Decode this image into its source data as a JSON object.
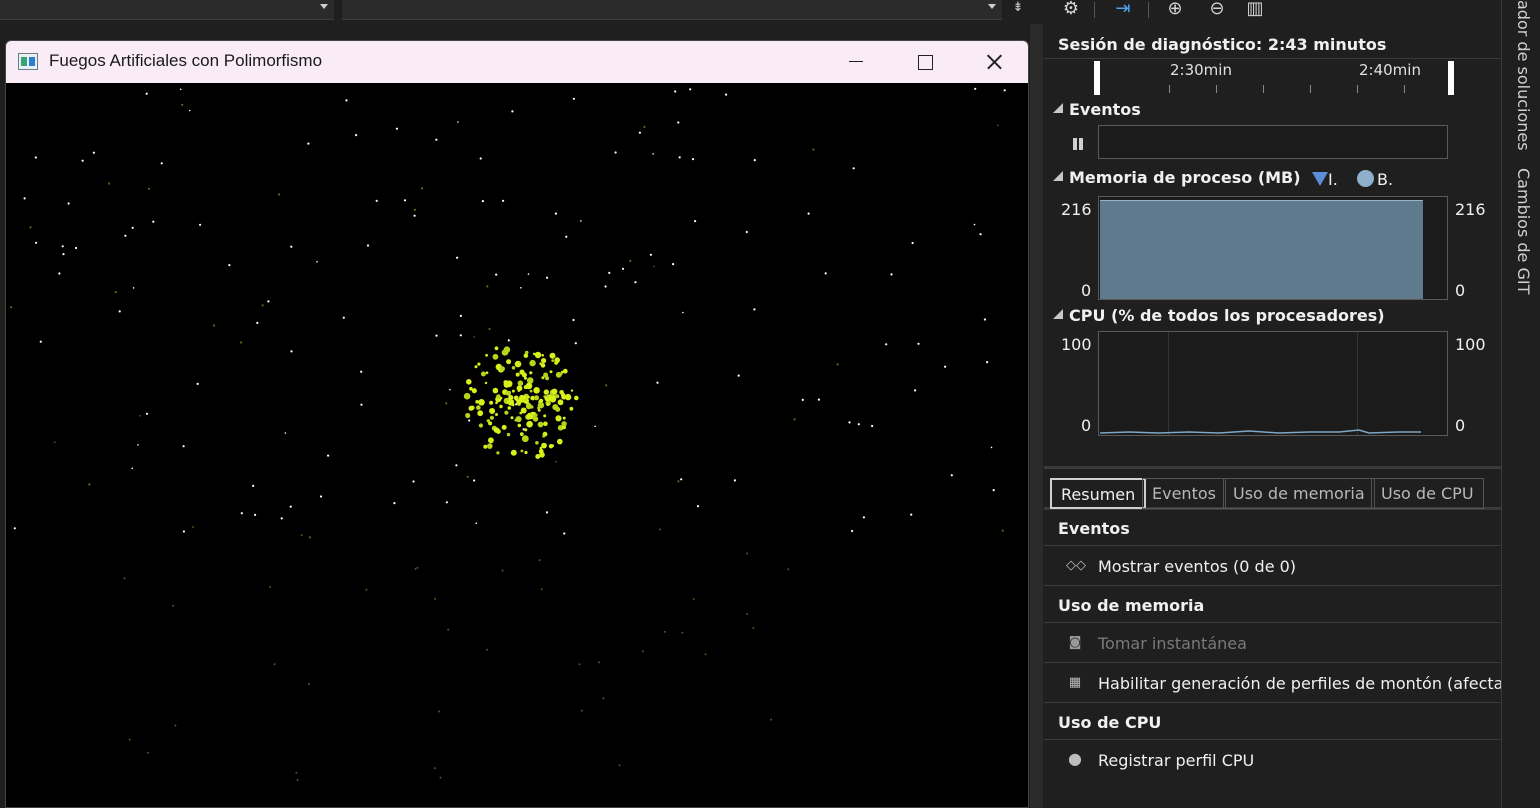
{
  "app_window": {
    "title": "Fuegos Artificiales con Polimorfismo",
    "minimize_icon": "minimize-icon",
    "maximize_icon": "maximize-icon",
    "close_icon": "close-icon",
    "background": "#000000",
    "firework_color": "#d8f01a"
  },
  "diagnostics": {
    "toolbar_icons": [
      "gear-icon",
      "export-icon",
      "zoom-in-icon",
      "zoom-out-icon",
      "chart-icon"
    ],
    "session_label": "Sesión de diagnóstico: 2:43 minutos",
    "timeline": {
      "labels": [
        "2:30min",
        "2:40min"
      ]
    },
    "events_section": {
      "title": "Eventos"
    },
    "memory_section": {
      "title": "Memoria de proceso (MB)",
      "legend": [
        {
          "label": "I.",
          "icon": "triangle-down-icon",
          "color": "#5b8fd8"
        },
        {
          "label": "B.",
          "icon": "circle-icon",
          "color": "#8fb0cc"
        }
      ],
      "axis_max": "216",
      "axis_min": "0",
      "fill_color": "#5f7a8c",
      "level_fraction": 0.97
    },
    "cpu_section": {
      "title": "CPU (% de todos los procesadores)",
      "axis_max": "100",
      "axis_min": "0",
      "line_color": "#7fa6c4"
    },
    "tabs": [
      {
        "label": "Resumen",
        "active": true
      },
      {
        "label": "Eventos",
        "active": false
      },
      {
        "label": "Uso de memoria",
        "active": false
      },
      {
        "label": "Uso de CPU",
        "active": false
      }
    ],
    "summary": {
      "events_head": "Eventos",
      "show_events": "Mostrar eventos (0 de 0)",
      "memory_head": "Uso de memoria",
      "take_snapshot": "Tomar instantánea",
      "enable_heap": "Habilitar generación de perfiles de montón (afecta",
      "cpu_head": "Uso de CPU",
      "record_cpu": "Registrar perfil CPU"
    }
  },
  "side_tabs": {
    "solution_explorer": "ador de soluciones",
    "git_changes": "Cambios de GIT"
  }
}
